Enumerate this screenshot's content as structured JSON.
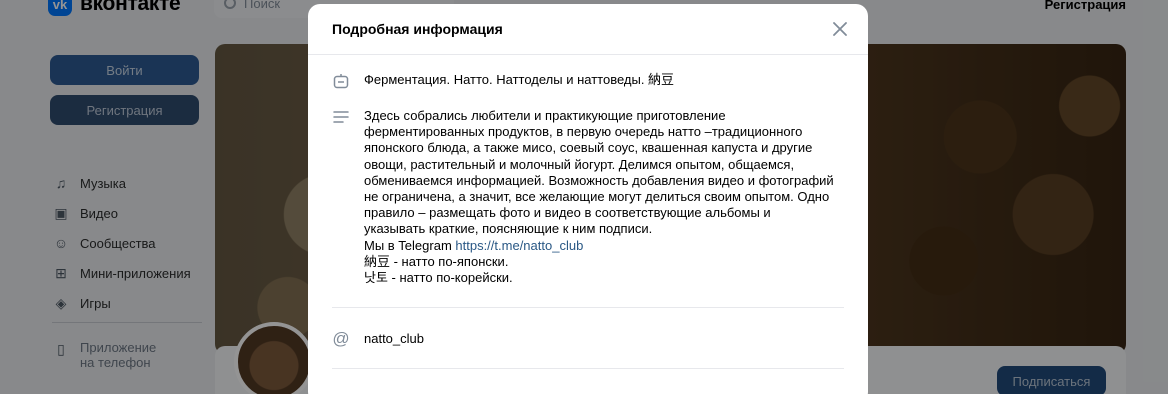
{
  "background": {
    "logo_text": "вконтакте",
    "logo_mark": "vk",
    "search_placeholder": "Поиск",
    "top_register": "Регистрация",
    "login_button": "Войти",
    "register_button": "Регистрация",
    "menu": [
      {
        "icon": "music-icon",
        "label": "Музыка"
      },
      {
        "icon": "video-icon",
        "label": "Видео"
      },
      {
        "icon": "communities-icon",
        "label": "Сообщества"
      },
      {
        "icon": "mini-apps-icon",
        "label": "Мини-приложения"
      },
      {
        "icon": "games-icon",
        "label": "Игры"
      }
    ],
    "app_line1": "Приложение",
    "app_line2": "на телефон",
    "subscribe_button": "Подписаться"
  },
  "modal": {
    "title": "Подробная информация",
    "close_icon": "close-icon",
    "name": "Ферментация. Натто. Наттоделы и наттоведы. 納豆",
    "description_lines": [
      "Здесь собрались любители и практикующие приготовление",
      "ферментированных продуктов, в первую очередь натто –традиционного",
      "японского блюда, а также мисо, соевый соус, квашенная капуста и другие",
      "овощи, растительный и молочный йогурт. Делимся опытом, общаемся,",
      "обмениваемся информацией. Возможность добавления видео и фотографий",
      "не ограничена, а значит, все желающие могут делиться своим опытом. Одно",
      "правило – размещать фото и видео в соответствующие альбомы и",
      "указывать краткие, поясняющие к ним подписи."
    ],
    "telegram_prefix": "Мы в Telegram ",
    "telegram_link": "https://t.me/natto_club",
    "line_japanese": "納豆 - натто по-японски.",
    "line_korean": "낫토 - натто по-корейски.",
    "short_address": "natto_club"
  },
  "colors": {
    "accent": "#0077ff",
    "link": "#2a5885",
    "icon": "#818c99"
  }
}
